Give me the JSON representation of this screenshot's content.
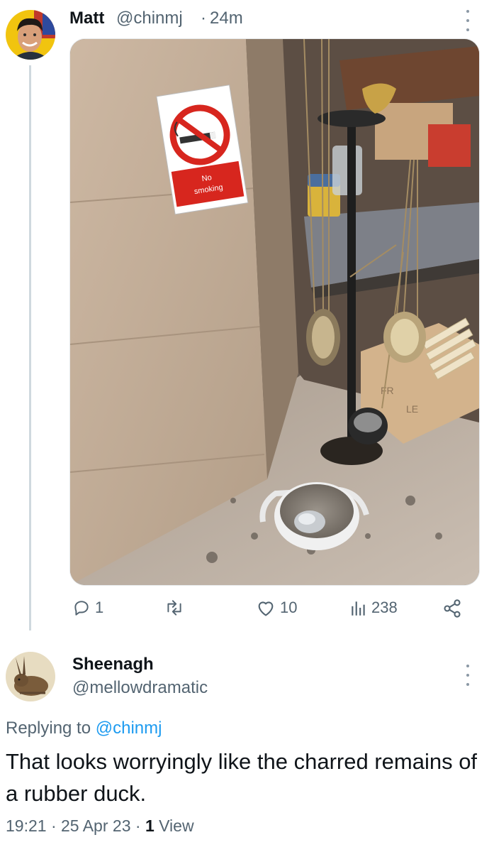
{
  "tweet": {
    "author_name": "Matt",
    "author_handle": "@chinmj",
    "separator": "·",
    "time_ago": "24m",
    "photo": {
      "sign_text_1": "No",
      "sign_text_2": "smoking",
      "box_text_1": "FR",
      "box_text_2": "LE"
    },
    "actions": {
      "replies": "1",
      "retweets": "",
      "likes": "10",
      "views": "238"
    },
    "icons": [
      "reply-icon",
      "retweet-icon",
      "like-icon",
      "views-icon",
      "share-icon",
      "more-icon"
    ]
  },
  "reply": {
    "author_name": "Sheenagh",
    "author_handle": "@mellowdramatic",
    "replying_prefix": "Replying to",
    "replying_handle": "@chinmj",
    "text": "That looks worryingly like the charred remains of a rubber duck.",
    "time": "19:21",
    "separator": "·",
    "date": "25 Apr 23",
    "views_count": "1",
    "views_label": "View"
  },
  "colors": {
    "link": "#1d9bf0",
    "secondary_text": "#536471",
    "primary_text": "#0f1419",
    "thread_line": "#cfd9de"
  }
}
